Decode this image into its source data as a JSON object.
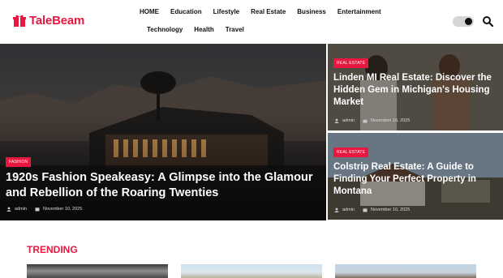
{
  "brand": {
    "name": "TaleBeam",
    "accent": "#e8173f"
  },
  "nav": {
    "row1": [
      "HOME",
      "Education",
      "Lifestyle",
      "Real Estate",
      "Business",
      "Entertainment"
    ],
    "row2": [
      "Technology",
      "Health",
      "Travel"
    ]
  },
  "header_icons": {
    "theme_toggle": "dark-mode-toggle",
    "search": "search-icon"
  },
  "hero": {
    "category": "FASHION",
    "title": "1920s Fashion Speakeasy: A Glimpse into the Glamour and Rebellion of the Roaring Twenties",
    "author": "admin",
    "date": "November 10, 2025"
  },
  "side_posts": [
    {
      "category": "REAL ESTATE",
      "title": "Linden MI Real Estate: Discover the Hidden Gem in Michigan's Housing Market",
      "author": "admin",
      "date": "November 10, 2025"
    },
    {
      "category": "REAL ESTATE",
      "title": "Colstrip Real Estate: A Guide to Finding Your Perfect Property in Montana",
      "author": "admin",
      "date": "November 10, 2025"
    }
  ],
  "trending": {
    "label": "TRENDING"
  }
}
